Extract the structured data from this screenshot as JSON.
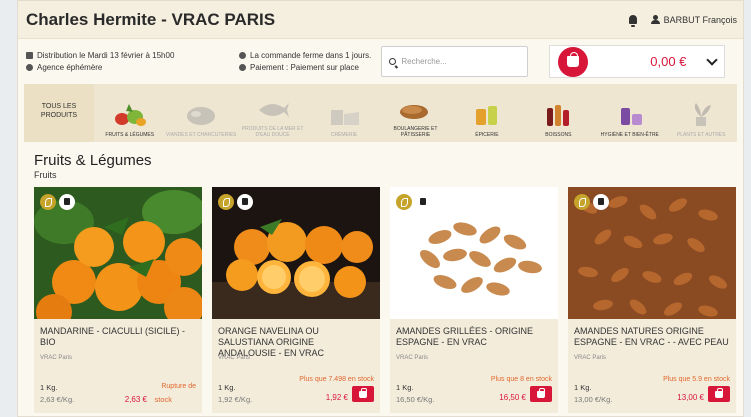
{
  "header": {
    "title": "Charles Hermite - VRAC PARIS",
    "user": "BARBUT François"
  },
  "info": {
    "distribution": "Distribution le Mardi 13 février à 15h00",
    "agency": "Agence éphémère",
    "closing": "La commande ferme dans 1 jours.",
    "payment": "Paiement : Paiement sur place"
  },
  "search": {
    "placeholder": "Recherche..."
  },
  "cart": {
    "total": "0,00 €"
  },
  "categories": {
    "all": "TOUS LES PRODUITS",
    "items": [
      "FRUITS & LÉGUMES",
      "VIANDES ET CHARCUTERIES",
      "PRODUITS DE LA MER ET D'EAU DOUCE",
      "CRÉMERIE",
      "BOULANGERIE ET PÂTISSERIE",
      "ÉPICERIE",
      "BOISSONS",
      "HYGIÈNE ET BIEN-ÊTRE",
      "PLANTS ET AUTRES"
    ]
  },
  "section": {
    "title": "Fruits & Légumes",
    "subtitle": "Fruits"
  },
  "products": [
    {
      "name": "MANDARINE - CIACULLI (SICILE) - BIO",
      "vendor": "VRAC Paris",
      "unit": "1 Kg.",
      "price_per": "2,63 €/Kg.",
      "price": "2,63 €",
      "stock_a": "Rupture de",
      "stock_b": "stock"
    },
    {
      "name": "ORANGE NAVELINA OU SALUSTIANA ORIGINE ANDALOUSIE - EN VRAC",
      "vendor": "VRAC Paris",
      "unit": "1 Kg.",
      "price_per": "1,92 €/Kg.",
      "price": "1,92 €",
      "stock": "Plus que 7.498 en stock"
    },
    {
      "name": "AMANDES GRILLÉES - ORIGINE ESPAGNE - EN VRAC",
      "vendor": "VRAC Paris",
      "unit": "1 Kg.",
      "price_per": "16,50 €/Kg.",
      "price": "16,50 €",
      "stock": "Plus que 8 en stock"
    },
    {
      "name": "AMANDES NATURES ORIGINE ESPAGNE - EN VRAC - - AVEC PEAU",
      "vendor": "VRAC Paris",
      "unit": "1 Kg.",
      "price_per": "13,00 €/Kg.",
      "price": "13,00 €",
      "stock": "Plus que 5.9 en stock"
    }
  ],
  "colors": {
    "accent": "#d8163a",
    "stock": "#e2672e",
    "cream": "#f3ecdb"
  }
}
